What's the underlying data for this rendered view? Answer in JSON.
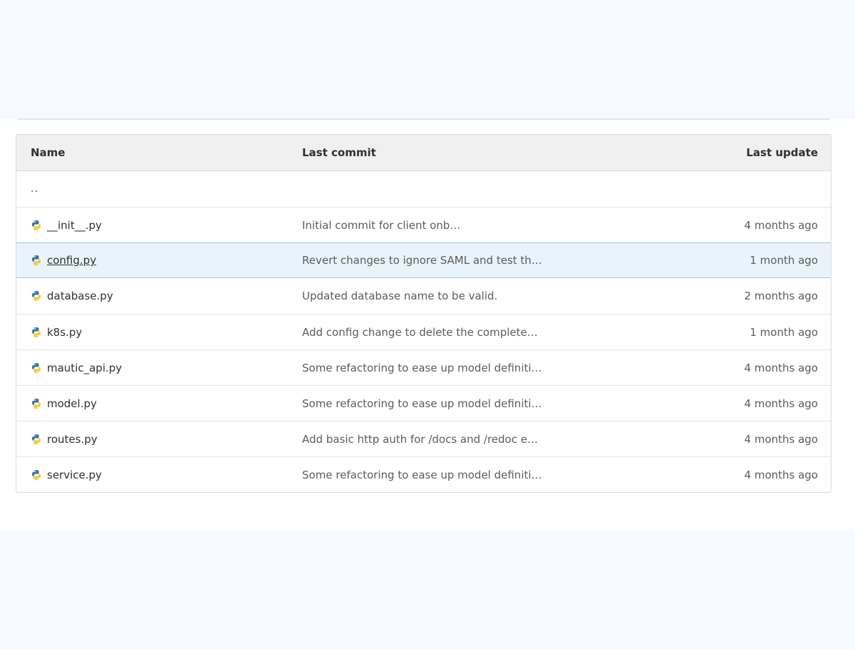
{
  "table": {
    "headers": {
      "name": "Name",
      "last_commit": "Last commit",
      "last_update": "Last update"
    },
    "parent_link": "..",
    "rows": [
      {
        "name": "__init__.py",
        "commit": "Initial commit for client onb…",
        "updated": "4 months ago",
        "icon": "python-file-icon"
      },
      {
        "name": "config.py",
        "commit": "Revert changes to ignore SAML and test th…",
        "updated": "1 month ago",
        "icon": "python-file-icon"
      },
      {
        "name": "database.py",
        "commit": "Updated database name to be valid.",
        "updated": "2 months ago",
        "icon": "python-file-icon"
      },
      {
        "name": "k8s.py",
        "commit": "Add config change to delete the complete…",
        "updated": "1 month ago",
        "icon": "python-file-icon"
      },
      {
        "name": "mautic_api.py",
        "commit": "Some refactoring to ease up model definiti…",
        "updated": "4 months ago",
        "icon": "python-file-icon"
      },
      {
        "name": "model.py",
        "commit": "Some refactoring to ease up model definiti…",
        "updated": "4 months ago",
        "icon": "python-file-icon"
      },
      {
        "name": "routes.py",
        "commit": "Add basic http auth for /docs and /redoc e…",
        "updated": "4 months ago",
        "icon": "python-file-icon"
      },
      {
        "name": "service.py",
        "commit": "Some refactoring to ease up model definiti…",
        "updated": "4 months ago",
        "icon": "python-file-icon"
      }
    ]
  },
  "colors": {
    "page_background": "#f6fafe",
    "header_background": "#f0f0f0",
    "highlight_background": "#e9f3fc",
    "python_blue": "#3673a5",
    "python_yellow": "#f8c928"
  }
}
